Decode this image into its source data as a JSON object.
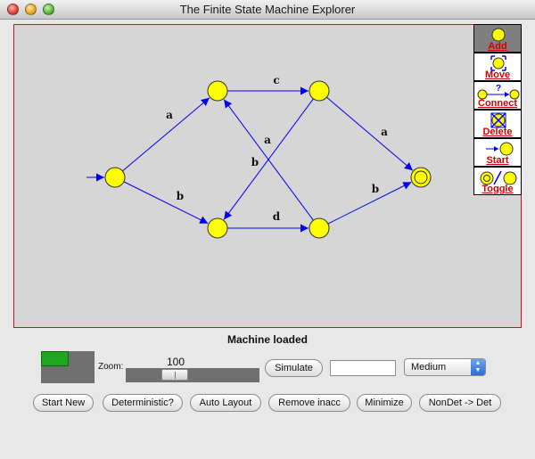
{
  "window": {
    "title": "The Finite State Machine Explorer"
  },
  "canvas": {
    "states": [
      {
        "id": "q0",
        "start": true,
        "accepting": false
      },
      {
        "id": "q1",
        "start": false,
        "accepting": false
      },
      {
        "id": "q2",
        "start": false,
        "accepting": false
      },
      {
        "id": "q3",
        "start": false,
        "accepting": false
      },
      {
        "id": "q4",
        "start": false,
        "accepting": false
      },
      {
        "id": "q5",
        "start": false,
        "accepting": true
      }
    ],
    "transitions": [
      {
        "from": "q0",
        "to": "q1",
        "label": "a"
      },
      {
        "from": "q0",
        "to": "q2",
        "label": "b"
      },
      {
        "from": "q1",
        "to": "q3",
        "label": "c"
      },
      {
        "from": "q2",
        "to": "q4",
        "label": "d"
      },
      {
        "from": "q3",
        "to": "q5",
        "label": "a"
      },
      {
        "from": "q3",
        "to": "q2",
        "label": "b"
      },
      {
        "from": "q4",
        "to": "q1",
        "label": "a"
      },
      {
        "from": "q4",
        "to": "q5",
        "label": "b"
      }
    ],
    "colors": {
      "node_fill": "#ffff00",
      "edge": "#0000ee",
      "border": "#c21a1a"
    }
  },
  "toolbar": {
    "tools": [
      {
        "label": "Add",
        "icon": "add-state-icon",
        "selected": true
      },
      {
        "label": "Move",
        "icon": "move-icon",
        "selected": false
      },
      {
        "label": "Connect",
        "icon": "connect-icon",
        "selected": false
      },
      {
        "label": "Delete",
        "icon": "delete-icon",
        "selected": false
      },
      {
        "label": "Start",
        "icon": "start-icon",
        "selected": false
      },
      {
        "label": "Toggle",
        "icon": "toggle-accept-icon",
        "selected": false
      }
    ]
  },
  "status": {
    "message": "Machine loaded"
  },
  "controls": {
    "zoom_label": "Zoom:",
    "zoom_value": "100",
    "simulate_label": "Simulate",
    "input_value": "",
    "speed_selected": "Medium"
  },
  "actions": {
    "start_new": "Start New",
    "deterministic": "Deterministic?",
    "auto_layout": "Auto Layout",
    "remove_inacc": "Remove inacc",
    "minimize": "Minimize",
    "nondet_to_det": "NonDet -> Det"
  }
}
